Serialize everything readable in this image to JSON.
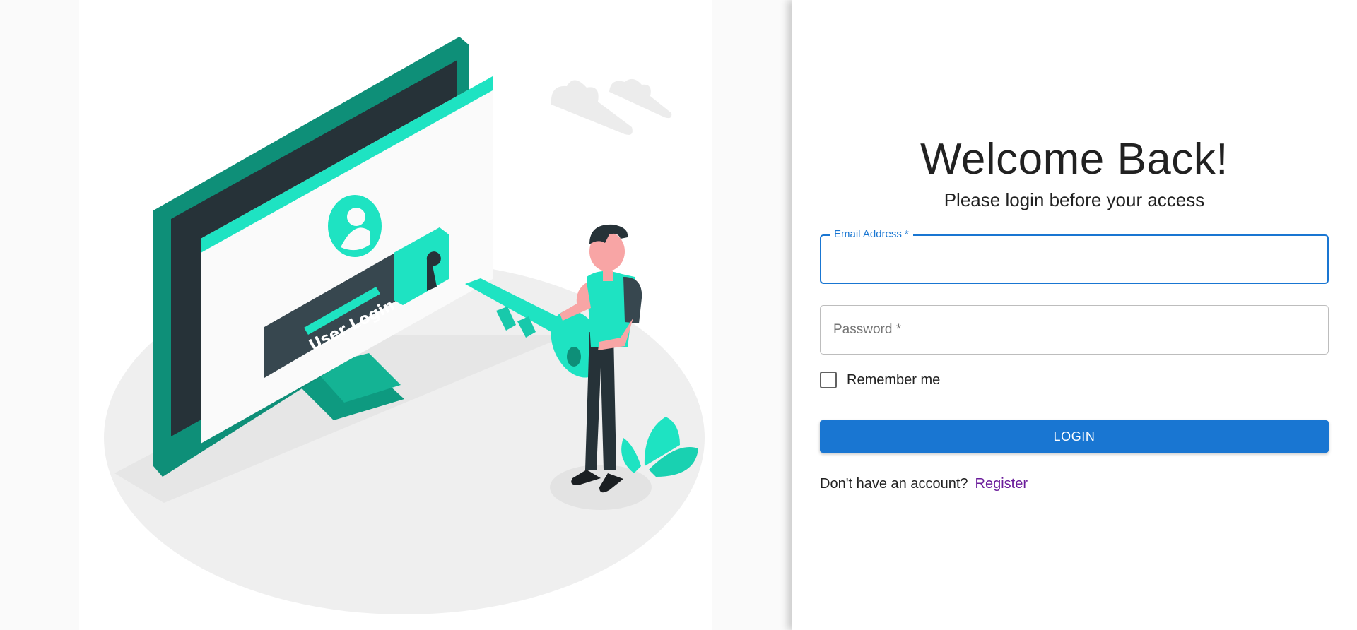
{
  "illustration": {
    "screen_label": "User Login",
    "colors": {
      "teal": "#1ee3c2",
      "dark_teal": "#0e8f78",
      "dark_slate": "#263238",
      "floor": "#efefef"
    }
  },
  "login": {
    "title": "Welcome Back!",
    "subtitle": "Please login before your access",
    "email_label": "Email Address *",
    "email_value": "",
    "password_placeholder": "Password *",
    "remember_label": "Remember me",
    "remember_checked": false,
    "submit_label": "LOGIN",
    "signup_prompt": "Don't have an account?",
    "signup_link": "Register"
  },
  "colors": {
    "primary": "#1976d2",
    "link": "#6a1b9a",
    "text": "#212121"
  }
}
